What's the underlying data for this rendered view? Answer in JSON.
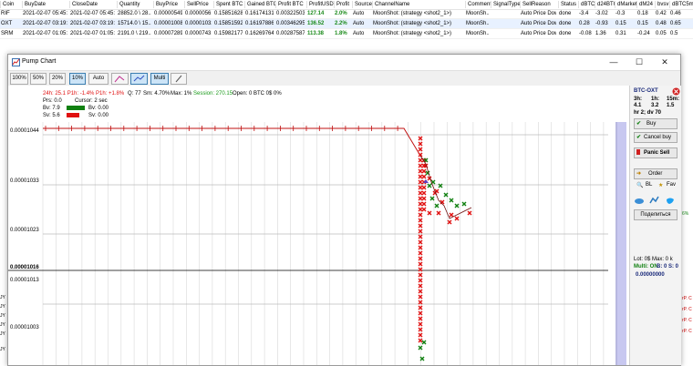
{
  "table": {
    "columns": [
      "Coin",
      "BuyDate",
      "CloseDate",
      "Quantity",
      "BuyPrice",
      "SellPrice",
      "Spent BTC",
      "Gained BTC",
      "Profit BTC",
      "ProfitUSDT",
      "Profit",
      "Source",
      "ChannelName",
      "Comment",
      "SignalType",
      "SellReason",
      "Status",
      "dBTC",
      "d24BTC",
      "dMarket",
      "dM24",
      "bvsv",
      "dBTC5m"
    ],
    "rows": [
      [
        "RIF",
        "2021-02-07 05:45:10",
        "2021-02-07 05:45:15",
        "28852.0 \\ 28...",
        "0.00000549",
        "0.00000561",
        "0.15851628",
        "0.16174131",
        "0.00322503",
        "127.14",
        "2.0%",
        "Auto",
        "MoonShot: (strategy <shot2_1>)",
        "MoonSh...",
        "",
        "Auto Price Down",
        "done",
        "-3.4",
        "-3.02",
        "-0.3",
        "0.18",
        "0.42",
        "0.46"
      ],
      [
        "OXT",
        "2021-02-07 03:19:02",
        "2021-02-07 03:19:04",
        "15714.0 \\ 15...",
        "0.00001008",
        "0.00001032",
        "0.15851592",
        "0.16197886",
        "0.00346295",
        "136.52",
        "2.2%",
        "Auto",
        "MoonShot: (strategy <shot2_1>)",
        "MoonSh...",
        "",
        "Auto Price Down",
        "done",
        "0.28",
        "-0.93",
        "0.15",
        "0.15",
        "0.48",
        "0.65"
      ],
      [
        "SRM",
        "2021-02-07 01:05:55",
        "2021-02-07 01:05:57",
        "2191.0 \\ 219...",
        "0.00007289",
        "0.00007431",
        "0.15982177",
        "0.16269764",
        "0.00287587",
        "113.38",
        "1.8%",
        "Auto",
        "MoonShot: (strategy <shot2_1>)",
        "MoonSh...",
        "",
        "Auto Price Down",
        "done",
        "-0.08",
        "1.36",
        "0.31",
        "-0.24",
        "0.05",
        "0.5"
      ]
    ]
  },
  "left_fragments": [
    "JY",
    "JY",
    "JY",
    "JY",
    "JY",
    "JY"
  ],
  "right_fragments": [
    "6%",
    "rP. C",
    "rP. C",
    "rP. C",
    "rP. C"
  ],
  "window": {
    "title": "Pump Chart",
    "minimize": "—",
    "maximize": "☐",
    "close": "✕"
  },
  "toolbar": {
    "buttons": [
      "100%",
      "50%",
      "20%",
      "10%",
      "Auto",
      "",
      "",
      "Multi",
      ""
    ]
  },
  "stats": {
    "line1_red": "24h: 25.1  P1h: -1.4%  P1h: +1.8%",
    "q": "Q: 77",
    "sm": "Sm: 4.70%",
    "max": "Max: 1%",
    "session": "Session: 270.15",
    "open": "Open: 0 BTC  0$  0%",
    "prs": "Prs: 0.0",
    "cursor": "Cursor: 2 sec",
    "bv": "Bv: 7.9",
    "bv0": "Bv: 0.00",
    "sv": "Sv: 5.6",
    "sv0": "Sv: 0.00"
  },
  "axis_labels": [
    "0.00001044",
    "0.00001033",
    "0.00001023",
    "0.00001016",
    "0.00001013",
    "0.00001003"
  ],
  "panel": {
    "pair": "BTC-OXT",
    "h3_label": "3h:",
    "h1_label": "1h:",
    "m15_label": "15m:",
    "h3": "4.1",
    "h1": "3.2",
    "m15": "1.5",
    "hr": "hr 2; dv 70",
    "buy": "Buy",
    "cancel_buy": "Cancel buy",
    "panic_sell": "Panic Sell",
    "order": "Order",
    "bl": "BL",
    "fav": "Fav",
    "share": "Поделиться",
    "lots": "Lot: 0$   Max: 0 k",
    "multi_on": "Multi: ON",
    "b_s": "B: 0  S: 0",
    "price": "0.00000000"
  },
  "colors": {
    "accent_red": "#e01010",
    "accent_green": "#1a9a1a",
    "sell_red": "#e01010",
    "buy_green": "#108010",
    "purple_band": "#c8c8f0"
  }
}
